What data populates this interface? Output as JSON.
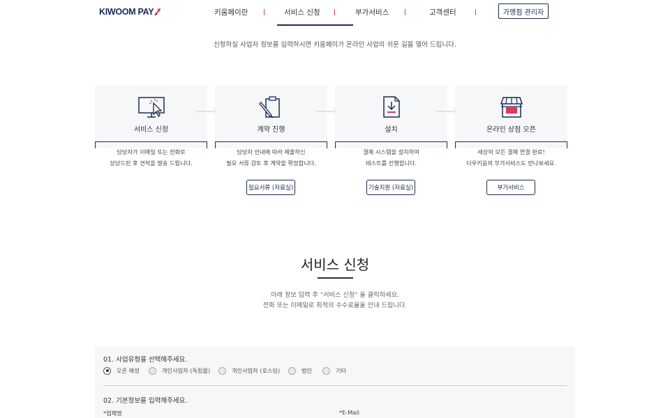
{
  "brand": {
    "logo_text": "KIWOOM PAY",
    "accent": "#e0385e",
    "navy": "#1b2a55"
  },
  "nav": {
    "items": [
      "키움페이란",
      "서비스 신청",
      "부가서비스",
      "고객센터"
    ],
    "admin_label": "가맹점 관리자"
  },
  "intro": "신청하실 사업자 정보를 입력하시면 키움페이가 온라인 사업의 쉬운 길을 열어 드립니다.",
  "steps": [
    {
      "title": "서비스 신청",
      "icon": "monitor-cursor-icon",
      "desc1": "담당자가 이메일 또는 전화로",
      "desc2": "상담드린 후 견적을 발송 드립니다."
    },
    {
      "title": "계약 진행",
      "icon": "clipboard-pen-icon",
      "desc1": "담당자 안내에 따라 제출하신",
      "desc2": "필요 서류 검토 후 계약을 확정합니다.",
      "button": "필요서류 (자료실)"
    },
    {
      "title": "설치",
      "icon": "document-download-icon",
      "desc1": "결제 시스템을 설치하여",
      "desc2": "테스트를 진행합니다.",
      "button": "기술지원 (자료실)"
    },
    {
      "title": "온라인 상점 오픈",
      "icon": "storefront-icon",
      "desc1": "세상의 모든 결제 연결 완료!",
      "desc2": "다우키움의 부가서비스도 만나보세요.",
      "button": "부가서비스"
    }
  ],
  "section": {
    "title": "서비스 신청",
    "desc1": "아래 정보 입력 후 \"서비스 신청\" 을 클릭하세요.",
    "desc2": "전화 또는 이메일로 최적의 수수료율을 안내 드립니다."
  },
  "form": {
    "q1": "01. 사업유형을 선택해주세요.",
    "options": [
      "오픈 예정",
      "개인사업자 (독립몰)",
      "개인사업자 (호스팅)",
      "법인",
      "기타"
    ],
    "selected": "오픈 예정",
    "q2": "02. 기본정보를 입력해주세요.",
    "field_company": "*업체명",
    "field_email": "*E-Mail"
  }
}
